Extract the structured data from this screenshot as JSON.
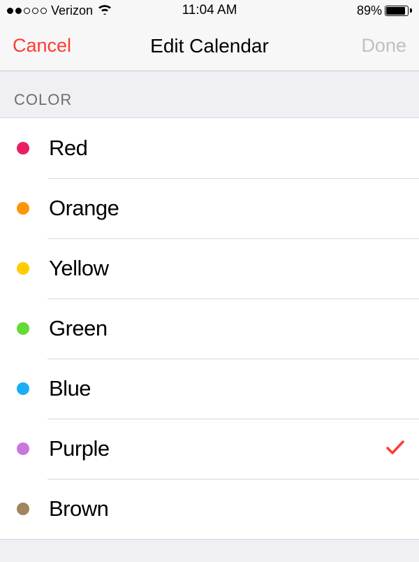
{
  "status": {
    "carrier": "Verizon",
    "time": "11:04 AM",
    "battery_pct": "89%",
    "battery_fill_pct": 89
  },
  "nav": {
    "cancel": "Cancel",
    "title": "Edit Calendar",
    "done": "Done"
  },
  "section_header": "COLOR",
  "colors": [
    {
      "label": "Red",
      "hex": "#e91e63",
      "selected": false
    },
    {
      "label": "Orange",
      "hex": "#ff9500",
      "selected": false
    },
    {
      "label": "Yellow",
      "hex": "#ffcc00",
      "selected": false
    },
    {
      "label": "Green",
      "hex": "#63da38",
      "selected": false
    },
    {
      "label": "Blue",
      "hex": "#1badf8",
      "selected": false
    },
    {
      "label": "Purple",
      "hex": "#c977dc",
      "selected": true
    },
    {
      "label": "Brown",
      "hex": "#a2845e",
      "selected": false
    }
  ]
}
